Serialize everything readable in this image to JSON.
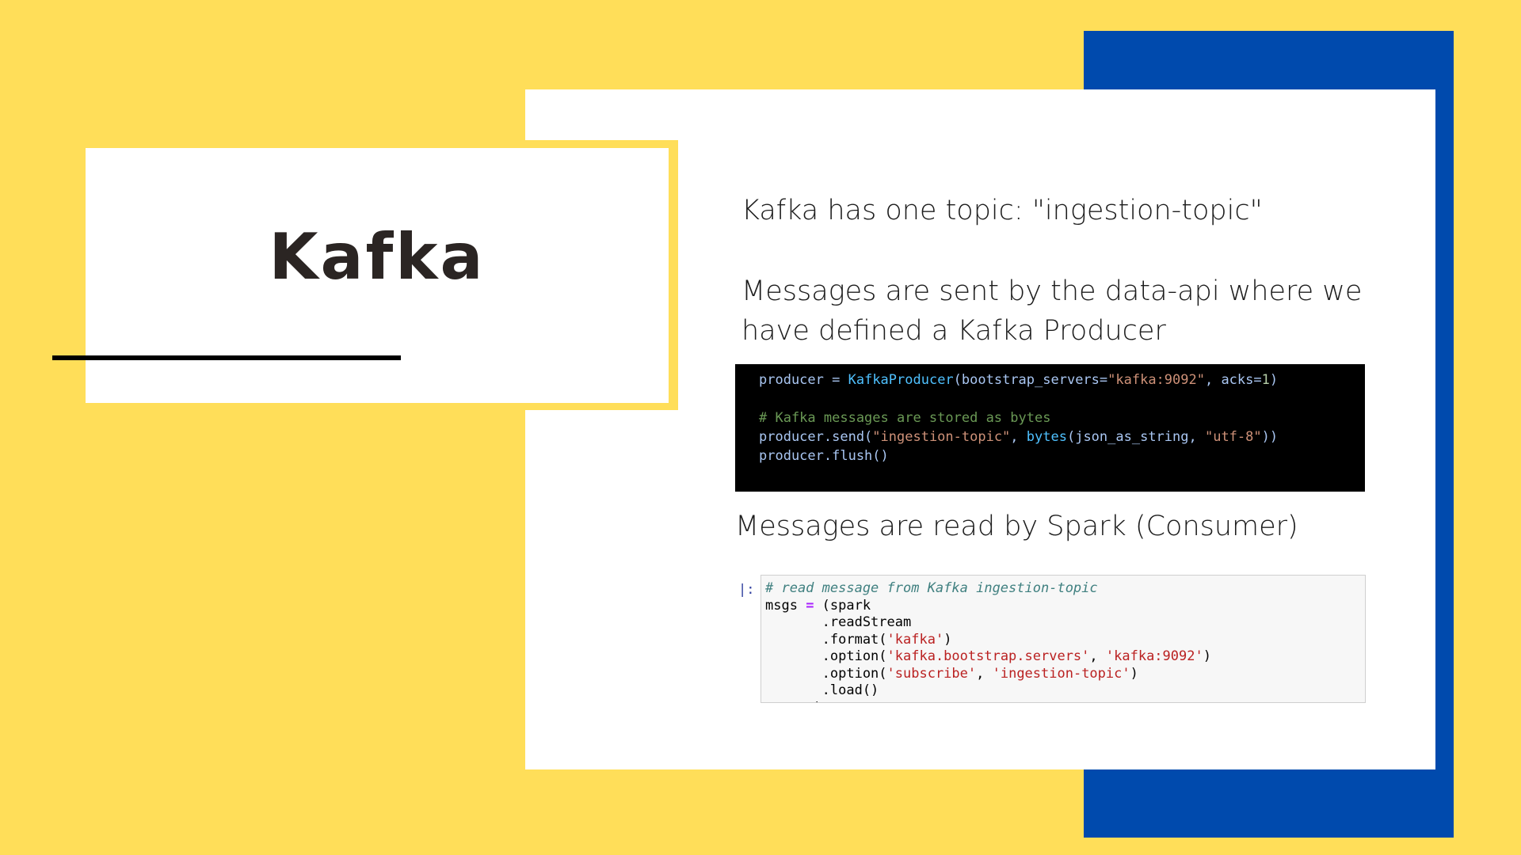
{
  "title": "Kafka",
  "paragraphs": {
    "topic": "Kafka has one topic: \"ingestion-topic\"",
    "producer": "Messages are sent by the data-api where we have defined a Kafka Producer",
    "consumer": "Messages are read by Spark (Consumer)"
  },
  "producer_code": {
    "line1": {
      "var": "producer",
      "eq": " = ",
      "cls": "KafkaProducer",
      "args1": "(bootstrap_servers=",
      "server": "\"kafka:9092\"",
      "args2": ", acks=",
      "acks": "1",
      "close": ")"
    },
    "comment": "# Kafka messages are stored as bytes",
    "line3": {
      "call": "producer.send(",
      "topic": "\"ingestion-topic\"",
      "sep": ", ",
      "fn": "bytes",
      "args": "(json_as_string, ",
      "enc": "\"utf-8\"",
      "close": "))"
    },
    "line4": "producer.flush()"
  },
  "consumer_code": {
    "prompt": "|:",
    "comment": "# read message from Kafka ingestion-topic",
    "line2": {
      "var": "msgs ",
      "op": "=",
      "rest": " (spark"
    },
    "line3": "       .readStream",
    "line4": {
      "pre": "       .format(",
      "s1": "'kafka'",
      "post": ")"
    },
    "line5": {
      "pre": "       .option(",
      "s1": "'kafka.bootstrap.servers'",
      "mid": ", ",
      "s2": "'kafka:9092'",
      "post": ")"
    },
    "line6": {
      "pre": "       .option(",
      "s1": "'subscribe'",
      "mid": ", ",
      "s2": "'ingestion-topic'",
      "post": ")"
    },
    "line7": "       .load()",
    "line8": "      )"
  },
  "colors": {
    "background": "#FFDE59",
    "accent_blue": "#004AAD",
    "card": "#FFFFFF"
  }
}
